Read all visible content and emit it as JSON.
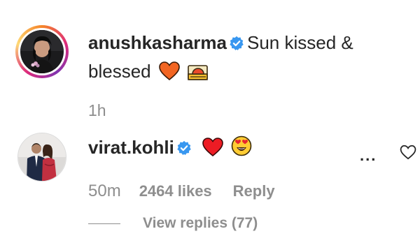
{
  "post": {
    "username": "anushkasharma",
    "caption_text": "Sun kissed & ",
    "caption_text_2": "blessed",
    "emojis": [
      "orange-heart-icon",
      "sunset-icon"
    ],
    "time": "1h"
  },
  "comment": {
    "username": "virat.kohli",
    "emojis": [
      "red-heart-icon",
      "heart-eyes-icon"
    ],
    "age": "50m",
    "likes": "2464 likes",
    "reply_label": "Reply",
    "view_replies": "View replies (77)",
    "more_label": "..."
  },
  "colors": {
    "text": "#262626",
    "muted": "#8e8e8e",
    "verified_blue": "#3897f0",
    "heart_red": "#ed1c24",
    "heart_orange": "#f26522"
  }
}
